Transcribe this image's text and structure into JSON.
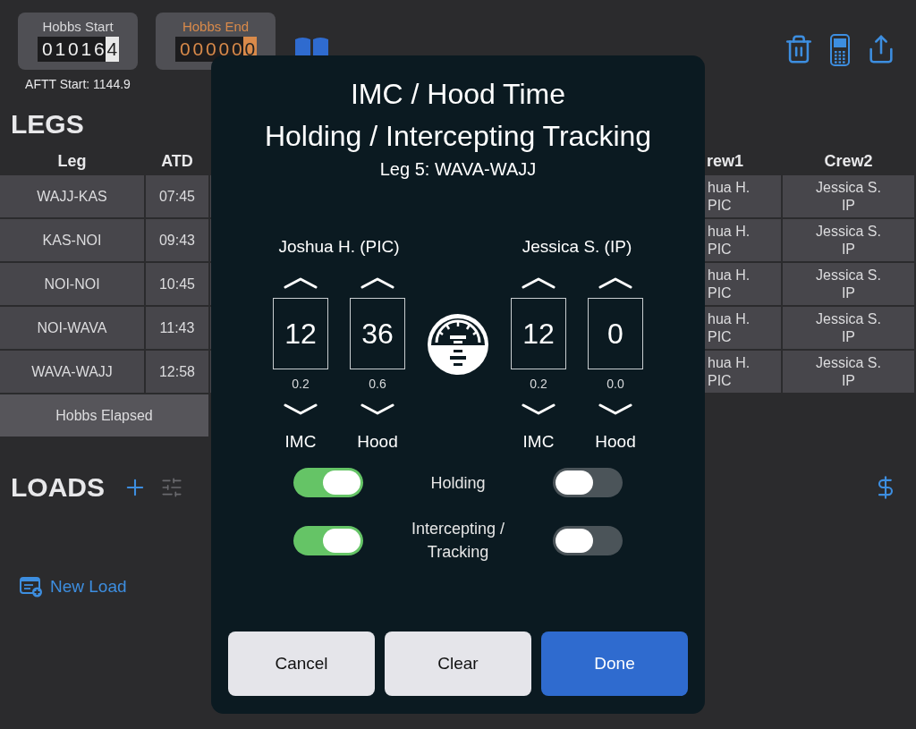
{
  "hobbs": [
    {
      "kind": "start",
      "label": "Hobbs Start",
      "digits": [
        "0",
        "1",
        "0",
        "1",
        "6",
        "4"
      ]
    },
    {
      "kind": "end",
      "label": "Hobbs End",
      "digits": [
        "0",
        "0",
        "0",
        "0",
        "0",
        "0"
      ]
    }
  ],
  "aftt_start": "AFTT Start: 1144.9",
  "legs_title": "LEGS",
  "legs_table": {
    "columns": [
      "Leg",
      "ATD",
      "rew1",
      "Crew2"
    ],
    "rows": [
      {
        "leg": "WAJJ-KAS",
        "atd": "07:45",
        "crew1": "hua H.\nPIC",
        "crew2": "Jessica S.\nIP"
      },
      {
        "leg": "KAS-NOI",
        "atd": "09:43",
        "crew1": "hua H.\nPIC",
        "crew2": "Jessica S.\nIP"
      },
      {
        "leg": "NOI-NOI",
        "atd": "10:45",
        "crew1": "hua H.\nPIC",
        "crew2": "Jessica S.\nIP"
      },
      {
        "leg": "NOI-WAVA",
        "atd": "11:43",
        "crew1": "hua H.\nPIC",
        "crew2": "Jessica S.\nIP"
      },
      {
        "leg": "WAVA-WAJJ",
        "atd": "12:58",
        "crew1": "hua H.\nPIC",
        "crew2": "Jessica S.\nIP"
      }
    ],
    "footer": "Hobbs Elapsed"
  },
  "loads_title": "LOADS",
  "new_load": "New Load",
  "modal": {
    "title_lines": [
      "IMC / Hood Time",
      "Holding / Intercepting Tracking"
    ],
    "subtitle": "Leg 5: WAVA-WAJJ",
    "crew": [
      {
        "name": "Joshua H. (PIC)",
        "counters": [
          {
            "label": "IMC",
            "value": "12",
            "hours": "0.2"
          },
          {
            "label": "Hood",
            "value": "36",
            "hours": "0.6"
          }
        ]
      },
      {
        "name": "Jessica S. (IP)",
        "counters": [
          {
            "label": "IMC",
            "value": "12",
            "hours": "0.2"
          },
          {
            "label": "Hood",
            "value": "0",
            "hours": "0.0"
          }
        ]
      }
    ],
    "toggle_rows": [
      {
        "label": "Holding",
        "switches": [
          {
            "on": true
          },
          {
            "on": false
          }
        ]
      },
      {
        "label": "Intercepting /\nTracking",
        "switches": [
          {
            "on": true
          },
          {
            "on": false
          }
        ]
      }
    ],
    "buttons": [
      {
        "label": "Cancel",
        "kind": "secondary"
      },
      {
        "label": "Clear",
        "kind": "secondary"
      },
      {
        "label": "Done",
        "kind": "primary"
      }
    ]
  }
}
